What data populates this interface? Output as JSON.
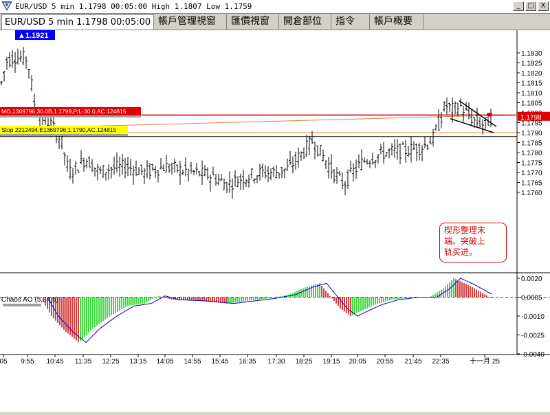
{
  "window": {
    "title": "EUR/USD 5 min 1.1798 00:05:00 High 1.1807 Low 1.1759",
    "controls": [
      "_",
      "□",
      "X"
    ]
  },
  "tabs": [
    {
      "label": "EUR/USD 5 min 1.1798 00:05:00",
      "active": true
    },
    {
      "label": "帳戶管理視窗",
      "active": false
    },
    {
      "label": "匯價視窗",
      "active": false
    },
    {
      "label": "開倉部位",
      "active": false
    },
    {
      "label": "指令",
      "active": false
    },
    {
      "label": "帳戶概要",
      "active": false
    }
  ],
  "chart": {
    "price_labels": [
      "1.1830",
      "1.1825",
      "1.1820",
      "1.1815",
      "1.1810",
      "1.1805",
      "1.1800",
      "1.1795",
      "1.1790",
      "1.1785",
      "1.1780",
      "1.1775",
      "1.1770",
      "1.1765",
      "1.1760"
    ],
    "current_price": "1.1798",
    "high_tag": "1.1921",
    "order_line_label": "MO,1369796,30.0B,1.1799,P/L-30.0,AC.124815",
    "stop_line_label": "Stop 2212494,E1369796,1.1790,AC.124815",
    "indicator_name": "Chaos AO (5,34,5)",
    "indicator_labels": [
      "0.0020",
      "0.0005",
      "-0.0010",
      "-0.0025",
      "-0.0040"
    ],
    "time_labels": [
      "05",
      "9:55",
      "10:45",
      "11:35",
      "12:25",
      "13:15",
      "14:05",
      "14:55",
      "15:45",
      "16:35",
      "17:30",
      "18:25",
      "19:15",
      "20:05",
      "20:55",
      "21:45",
      "22:35",
      "十一月 25"
    ],
    "annotation_lines": [
      "楔形整理末",
      "端。突破上",
      "轨买进。"
    ],
    "colors": {
      "accent_red": "#e00000",
      "ao_up": "#00cc00",
      "ao_down": "#cc0000",
      "stop_bg": "#ffff00",
      "tag_bg": "#0000ff"
    }
  }
}
